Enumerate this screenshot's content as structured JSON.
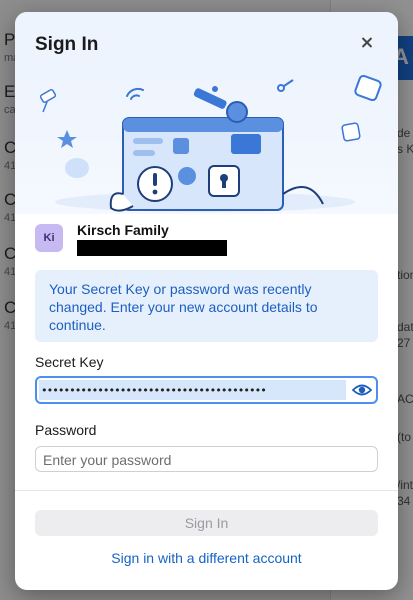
{
  "background": {
    "rows": [
      {
        "title": "P",
        "sub": "ma"
      },
      {
        "title": "E",
        "sub": "ca"
      },
      {
        "title": "C",
        "sub": "41"
      },
      {
        "title": "C",
        "sub": "41"
      },
      {
        "title": "C",
        "sub": "41"
      },
      {
        "title": "C",
        "sub": "41"
      }
    ],
    "right_fragments": [
      "de",
      "s K",
      "tion",
      "dat",
      "27",
      "ACT",
      "(to",
      "/int",
      "34"
    ],
    "badge": "A"
  },
  "modal": {
    "title": "Sign In",
    "close_icon": "close-icon"
  },
  "account": {
    "avatar_initials": "Ki",
    "name": "Kirsch Family"
  },
  "notice": {
    "text": "Your Secret Key or password was recently changed. Enter your new account details to continue."
  },
  "secret_key": {
    "label": "Secret Key",
    "value": "••••••••••••••••••••••••••••••••••••••••",
    "icon": "eye-icon"
  },
  "password": {
    "label": "Password",
    "placeholder": "Enter your password",
    "value": ""
  },
  "actions": {
    "sign_in_label": "Sign In",
    "different_account_label": "Sign in with a different account"
  },
  "colors": {
    "accent": "#1663c7",
    "focus_border": "#4d8ef0",
    "notice_bg": "#e6f0fd",
    "avatar_bg": "#c7b9f2"
  }
}
